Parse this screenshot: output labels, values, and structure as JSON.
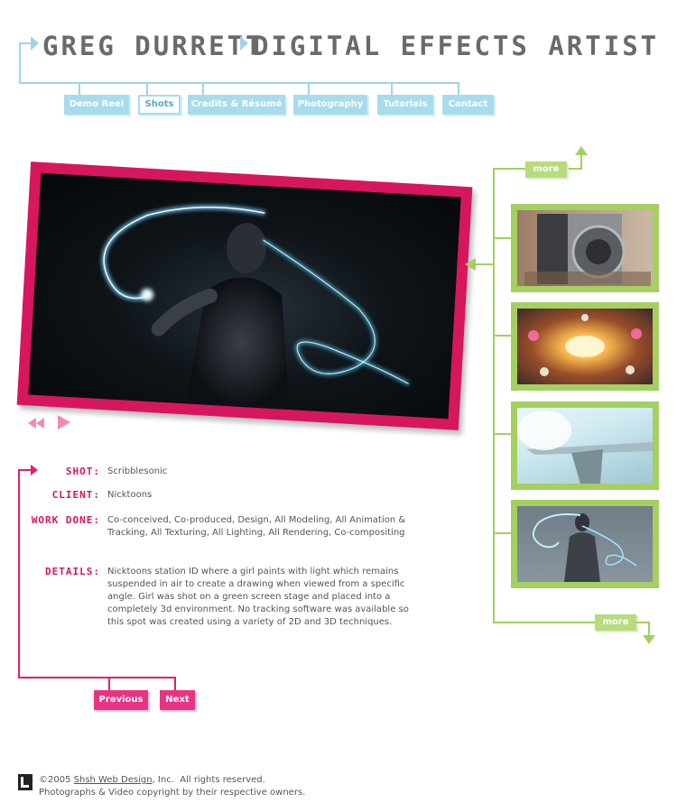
{
  "header": {
    "name": "GREG DURRETT",
    "subtitle": "DIGITAL EFFECTS ARTIST"
  },
  "nav": {
    "items": [
      "Demo Reel",
      "Shots",
      "Credits & Résumé",
      "Photography",
      "Tutorials",
      "Contact"
    ],
    "active": "Shots"
  },
  "thumbnails": {
    "more_top": "more",
    "more_bottom": "more",
    "items": [
      "subwoofer-thumb",
      "burst-thumb",
      "aircraft-thumb",
      "light-paint-thumb"
    ]
  },
  "shot": {
    "labels": {
      "shot": "SHOT:",
      "client": "CLIENT:",
      "work_done": "WORK DONE:",
      "details": "DETAILS:"
    },
    "name": "Scribblesonic",
    "client": "Nicktoons",
    "work_done": "Co-conceived, Co-produced, Design, All Modeling, All Animation & Tracking, All Texturing, All Lighting, All Rendering, Co-compositing",
    "details": "Nicktoons station ID where a girl paints with light which remains suspended in air to create a drawing when viewed from a specific angle. Girl was shot on a green screen stage and placed into a completely 3d environment. No tracking software was available so this spot was created using a variety of 2D and 3D techniques."
  },
  "pager": {
    "previous": "Previous",
    "next": "Next"
  },
  "footer": {
    "copyright_prefix": "©2005",
    "company": "Shsh Web Design",
    "copyright_suffix": ", Inc.  All rights reserved.",
    "line2": "Photographs & Video copyright by their respective owners."
  },
  "colors": {
    "blue_accent": "#9fd4ea",
    "pink_accent": "#d6165e",
    "green_accent": "#a4cf61",
    "title_gray": "#6a6a6a"
  }
}
